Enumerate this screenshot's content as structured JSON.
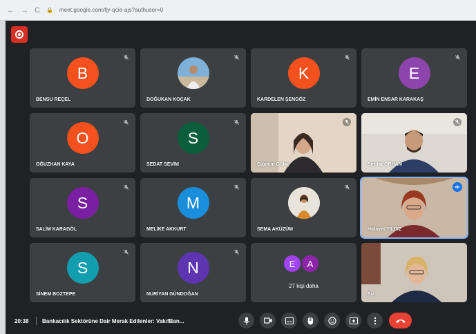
{
  "browser": {
    "url": "meet.google.com/fjy-qcie-ajs?authuser=0"
  },
  "meeting": {
    "time": "20:38",
    "title": "Bankacılık Sektörüne Dair Merak Edilenler: VakıfBan..."
  },
  "colors": {
    "background": "#202124",
    "tile": "#3c4043",
    "end_call": "#ea4335",
    "record": "#d93025",
    "speaking_outline": "#8ab4f8"
  },
  "participants": [
    {
      "name": "BENSU REÇEL",
      "initial": "B",
      "color": "#f4511e",
      "muted": true
    },
    {
      "name": "DOĞUKAN KOÇAK",
      "photo": "person-photo",
      "muted": true
    },
    {
      "name": "KARDELEN ŞENGÖZ",
      "initial": "K",
      "color": "#f4511e",
      "muted": true
    },
    {
      "name": "EMİN ENSAR KARAKAŞ",
      "initial": "E",
      "color": "#8e44ad",
      "muted": true
    },
    {
      "name": "OĞUZHAN KAYA",
      "initial": "O",
      "color": "#f4511e",
      "muted": true
    },
    {
      "name": "SEDAT SEVİM",
      "initial": "S",
      "color": "#0b5e3b",
      "muted": true
    },
    {
      "name": "Çiğdem Gülaç",
      "video": true,
      "muted": true
    },
    {
      "name": "Serdar ORHAN",
      "video": true,
      "muted": true
    },
    {
      "name": "SALİM KARAGÖL",
      "initial": "S",
      "color": "#7b1fa2",
      "muted": true
    },
    {
      "name": "MELİKE AKKURT",
      "initial": "M",
      "color": "#1a8ddb",
      "muted": true
    },
    {
      "name": "SEMA AKÜZÜM",
      "photo": "person-photo",
      "muted": true
    },
    {
      "name": "Hidayet YILDIZ",
      "video": true,
      "speaking": true
    },
    {
      "name": "SİNEM BOZTEPE",
      "initial": "S",
      "color": "#129eaf",
      "muted": true
    },
    {
      "name": "NURİYAN GÜNDOĞAN",
      "initial": "N",
      "color": "#5e35b1",
      "muted": true
    },
    {
      "name": "Siz",
      "video": true
    }
  ],
  "more_tile": {
    "initials": [
      "E",
      "A"
    ],
    "colors": [
      "#a142f4",
      "#8e24aa"
    ],
    "label": "27 kişi daha"
  },
  "controls": [
    "microphone-icon",
    "camera-icon",
    "captions-icon",
    "raise-hand-icon",
    "emoji-icon",
    "present-icon",
    "more-options-icon",
    "end-call-icon"
  ]
}
